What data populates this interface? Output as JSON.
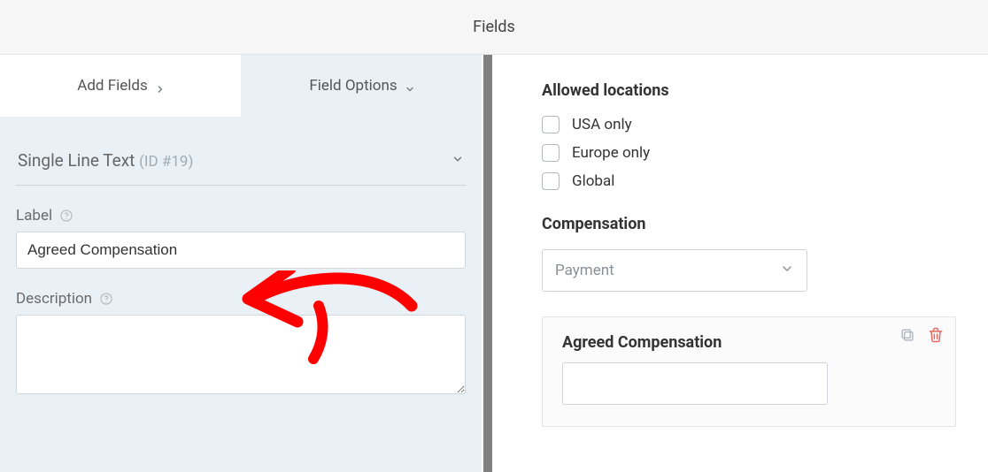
{
  "header": {
    "title": "Fields"
  },
  "tabs": {
    "add_fields": "Add Fields",
    "field_options": "Field Options"
  },
  "section": {
    "type_label": "Single Line Text",
    "id_label": "(ID #19)"
  },
  "form": {
    "label_caption": "Label",
    "label_value": "Agreed Compensation",
    "description_caption": "Description",
    "description_value": ""
  },
  "preview": {
    "allowed_locations_title": "Allowed locations",
    "locations": [
      {
        "label": "USA only"
      },
      {
        "label": "Europe only"
      },
      {
        "label": "Global"
      }
    ],
    "compensation_title": "Compensation",
    "compensation_placeholder": "Payment",
    "card_label": "Agreed Compensation"
  },
  "icons": {
    "chevron_right": "chevron-right",
    "chevron_down": "chevron-down",
    "help": "help-circle",
    "duplicate": "duplicate",
    "trash": "trash"
  },
  "annotation": {
    "type": "arrow",
    "color": "#ff0000"
  }
}
